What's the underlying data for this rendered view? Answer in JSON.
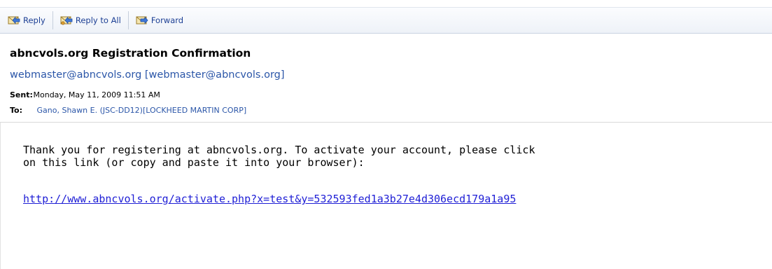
{
  "toolbar": {
    "reply_label": "Reply",
    "reply_all_label": "Reply to All",
    "forward_label": "Forward"
  },
  "message": {
    "subject": "abncvols.org Registration Confirmation",
    "from": "webmaster@abncvols.org [webmaster@abncvols.org]",
    "sent_label": "Sent:",
    "sent_value": "Monday, May 11, 2009 11:51 AM",
    "to_label": "To:",
    "to_value": "Gano, Shawn E. (JSC-DD12)[LOCKHEED MARTIN CORP]",
    "body_line1": "Thank you for registering at abncvols.org. To activate your account, please click",
    "body_line2": "on this link (or copy and paste it into your browser):",
    "activation_link": "http://www.abncvols.org/activate.php?x=test&y=532593fed1a3b27e4d306ecd179a1a95"
  },
  "colors": {
    "link": "#1f1fd6",
    "sender": "#2b56a8",
    "toolbar_text": "#1c3f94"
  },
  "icons": {
    "reply": "envelope-reply-icon",
    "reply_all": "envelope-reply-all-icon",
    "forward": "envelope-forward-icon"
  }
}
